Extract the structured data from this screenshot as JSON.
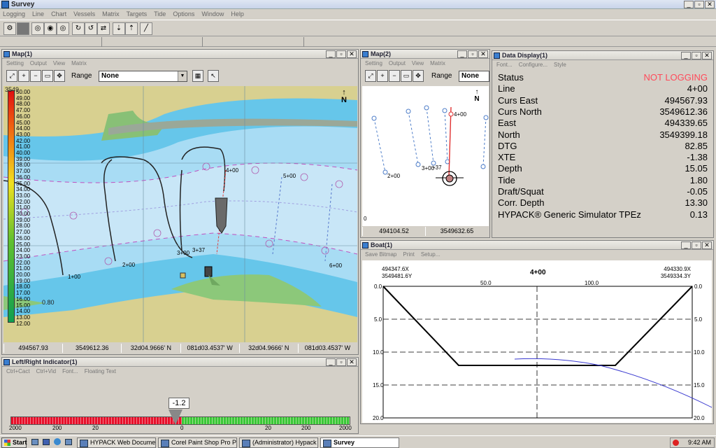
{
  "app": {
    "title": "Survey",
    "menu": [
      "Logging",
      "Line",
      "Chart",
      "Vessels",
      "Matrix",
      "Targets",
      "Tide",
      "Options",
      "Window",
      "Help"
    ],
    "window_buttons": [
      "_",
      "▫",
      "✕"
    ]
  },
  "map1": {
    "title": "Map(1)",
    "menu": [
      "Setting",
      "Output",
      "View",
      "Matrix"
    ],
    "range_label": "Range",
    "range_value": "None",
    "north_label": "N",
    "depth_scale": [
      "50.00",
      "49.00",
      "48.00",
      "47.00",
      "46.00",
      "45.00",
      "44.00",
      "43.00",
      "42.00",
      "41.00",
      "40.00",
      "39.00",
      "38.00",
      "37.00",
      "36.00",
      "35.00",
      "34.00",
      "33.00",
      "32.00",
      "31.00",
      "30.00",
      "29.00",
      "28.00",
      "27.00",
      "26.00",
      "25.00",
      "24.00",
      "23.00",
      "22.00",
      "21.00",
      "20.00",
      "19.00",
      "18.00",
      "17.00",
      "16.00",
      "15.00",
      "14.00",
      "13.00",
      "12.00"
    ],
    "scale_overlay_top": "3549",
    "scale_overlay_bottom": "0.80",
    "line_labels": [
      "4+00",
      "5+00",
      "3+37",
      "3+00",
      "2+00",
      "1+00",
      "6+00"
    ],
    "coords": [
      "494567.93",
      "3549612.36",
      "32d04.9666' N",
      "081d03.4537' W",
      "32d04.9666' N",
      "081d03.4537' W"
    ]
  },
  "map2": {
    "title": "Map(2)",
    "menu": [
      "Setting",
      "Output",
      "View",
      "Matrix"
    ],
    "range_label": "Range",
    "range_value": "None",
    "north_label": "N",
    "line_labels": [
      "4+00",
      "3+00",
      "+37",
      "2+00"
    ],
    "axis_zero": "0",
    "coords": [
      "494104.52",
      "3549632.65"
    ]
  },
  "data_display": {
    "title": "Data Display(1)",
    "menu": [
      "Font...",
      "Configure...",
      "Style"
    ],
    "rows": [
      {
        "label": "Status",
        "value": "NOT LOGGING",
        "alert": true
      },
      {
        "label": "Line",
        "value": "4+00"
      },
      {
        "label": "Curs East",
        "value": "494567.93"
      },
      {
        "label": "Curs North",
        "value": "3549612.36"
      },
      {
        "label": "East",
        "value": "494339.65"
      },
      {
        "label": "North",
        "value": "3549399.18"
      },
      {
        "label": "DTG",
        "value": "82.85"
      },
      {
        "label": "XTE",
        "value": "-1.38"
      },
      {
        "label": "Depth",
        "value": "15.05"
      },
      {
        "label": "Tide",
        "value": "1.80"
      },
      {
        "label": "Draft/Squat",
        "value": "-0.05"
      },
      {
        "label": "Corr. Depth",
        "value": "13.30"
      },
      {
        "label": "HYPACK® Generic Simulator TPEz",
        "value": "0.13"
      }
    ]
  },
  "boat": {
    "title": "Boat(1)",
    "menu": [
      "Save Bitmap",
      "Print",
      "Setup..."
    ],
    "line_title": "4+00",
    "left_coords": [
      "494347.6X",
      "3549481.6Y"
    ],
    "right_coords": [
      "494330.9X",
      "3549334.3Y"
    ],
    "x_ticks": [
      "50.0",
      "100.0"
    ],
    "y_ticks": [
      "0.0",
      "5.0",
      "10.0",
      "15.0",
      "20.0"
    ],
    "colors": {
      "profile": "#000000",
      "track": "#3a3ad0"
    }
  },
  "lr_indicator": {
    "title": "Left/Right Indicator(1)",
    "menu": [
      "Ctrl+Cact",
      "Ctrl+Vid",
      "Font...",
      "Floating Text"
    ],
    "value": "-1.2",
    "scale": [
      "2000",
      "200",
      "20",
      "0",
      "20",
      "200",
      "2000"
    ],
    "colors": {
      "left": "#e8102a",
      "right": "#3ac838"
    }
  },
  "taskbar": {
    "start": "Start",
    "tasks": [
      "HYPACK Web Document...",
      "Corel Paint Shop Pro Phot...",
      "(Administrator) Hypack - ...",
      "Survey"
    ],
    "time": "9:42 AM"
  }
}
